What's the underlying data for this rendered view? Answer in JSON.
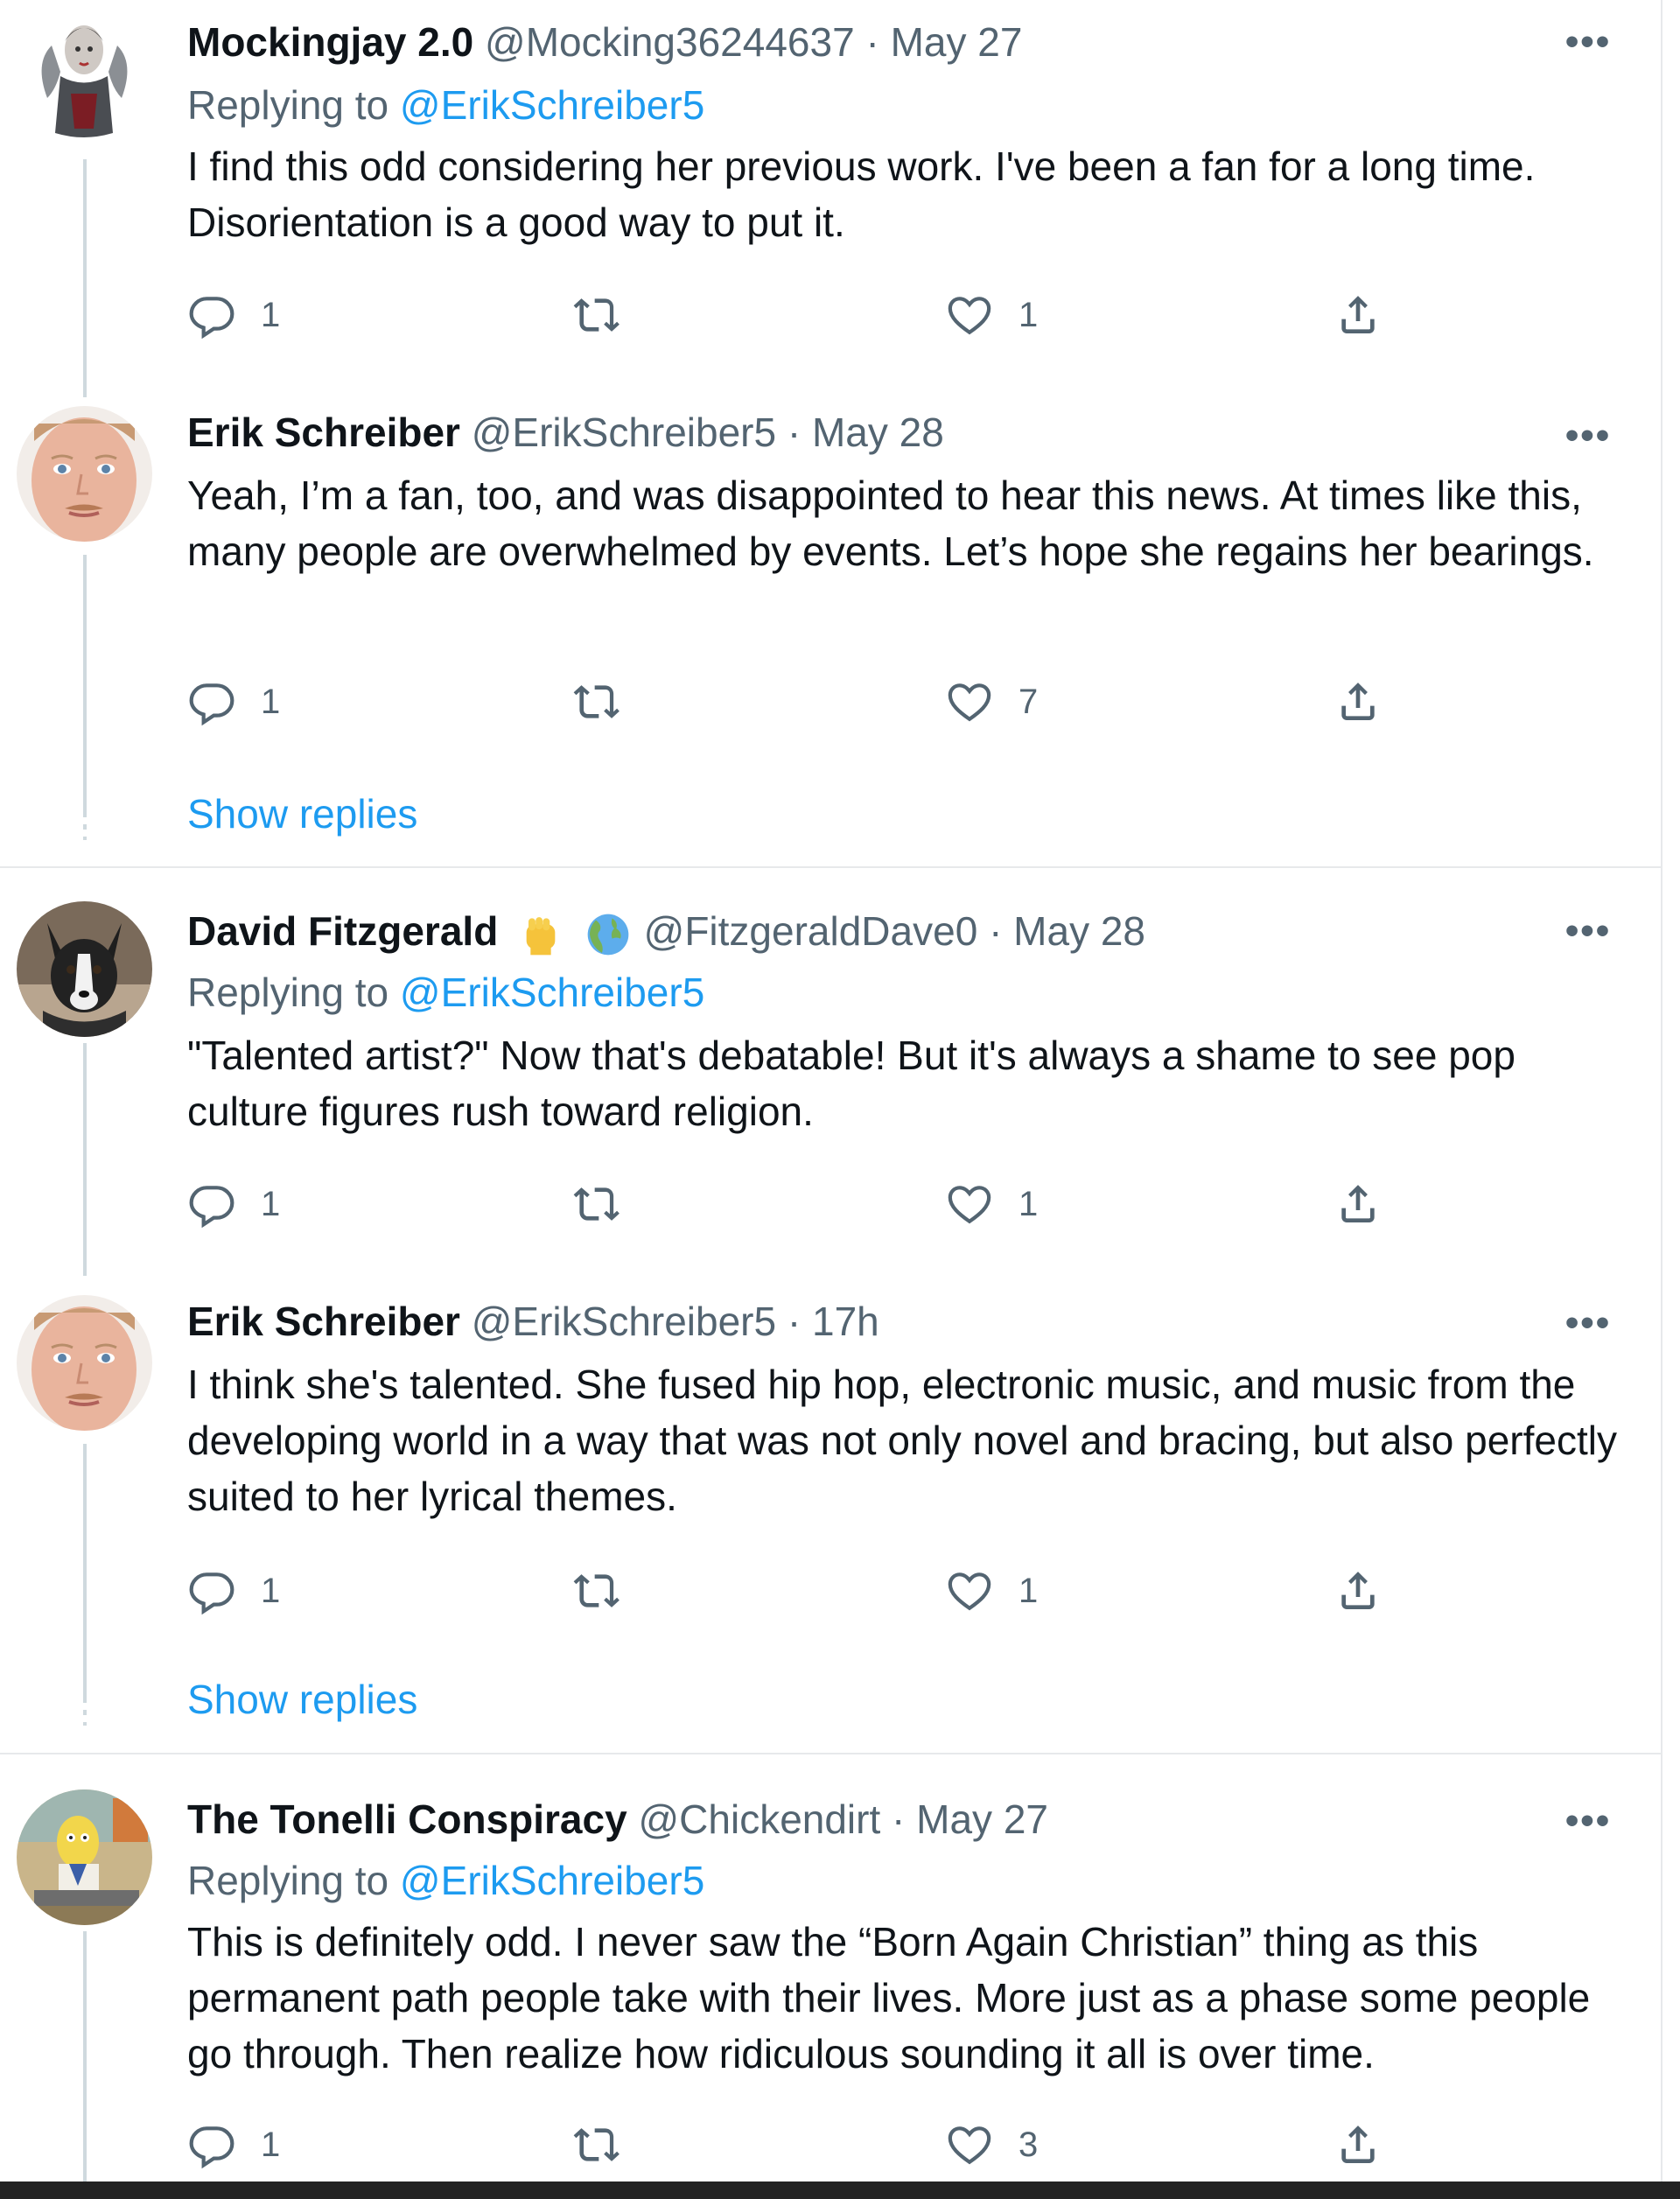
{
  "tweets": [
    {
      "name": "Mockingjay 2.0",
      "handle": "@Mocking36244637",
      "sep": "·",
      "time": "May 27",
      "replying_prefix": "Replying to",
      "replying_to": "@ErikSchreiber5",
      "text": "I find this odd considering her previous work. I've been a fan for a long time. Disorientation is a good way to put it.",
      "replies": "1",
      "retweets": "",
      "likes": "1",
      "more": "•••"
    },
    {
      "name": "Erik Schreiber",
      "handle": "@ErikSchreiber5",
      "sep": "·",
      "time": "May 28",
      "text": "Yeah, I’m a fan, too, and was disappointed to hear this news. At times like this, many people are overwhelmed by events. Let’s hope she regains her bearings.",
      "replies": "1",
      "retweets": "",
      "likes": "7",
      "more": "•••",
      "show_replies": "Show replies"
    },
    {
      "name": "David Fitzgerald",
      "handle": "@FitzgeraldDave0",
      "sep": "·",
      "time": "May 28",
      "replying_prefix": "Replying to",
      "replying_to": "@ErikSchreiber5",
      "text": "\"Talented artist?\" Now that's debatable! But it's always a shame to see pop culture figures rush toward religion.",
      "replies": "1",
      "retweets": "",
      "likes": "1",
      "more": "•••"
    },
    {
      "name": "Erik Schreiber",
      "handle": "@ErikSchreiber5",
      "sep": "·",
      "time": "17h",
      "text": "I think she's talented. She fused hip hop, electronic music, and music from the developing world in a way that was not only novel and bracing, but also perfectly suited to her lyrical themes.",
      "replies": "1",
      "retweets": "",
      "likes": "1",
      "more": "•••",
      "show_replies": "Show replies"
    },
    {
      "name": "The Tonelli Conspiracy",
      "handle": "@Chickendirt",
      "sep": "·",
      "time": "May 27",
      "replying_prefix": "Replying to",
      "replying_to": "@ErikSchreiber5",
      "text": "This is definitely odd. I never saw the “Born Again Christian” thing as this permanent path people take with their lives. More just as a phase some people go through. Then realize how ridiculous sounding it all is over time.",
      "replies": "1",
      "retweets": "",
      "likes": "3",
      "more": "•••"
    }
  ],
  "icons": {
    "reply": "reply-icon",
    "retweet": "retweet-icon",
    "like": "like-icon",
    "share": "share-icon",
    "badge": [
      "raised-fist-emoji",
      "globe-emoji"
    ]
  },
  "colors": {
    "link": "#1d9bf0",
    "secondary": "#536471",
    "thread": "#cfd9de",
    "divider": "#e7e9eb"
  }
}
